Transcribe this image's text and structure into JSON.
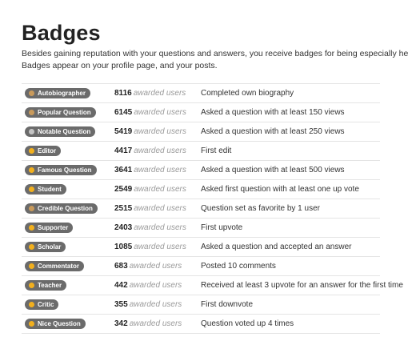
{
  "page": {
    "title": "Badges",
    "intro_line1": "Besides gaining reputation with your questions and answers, you receive badges for being especially helpful.",
    "intro_line2": "Badges appear on your profile  page, and your posts."
  },
  "awarded_label": "awarded users",
  "colors": {
    "gold": "#f2b01e",
    "silver": "#c4c4c4",
    "bronze": "#c99a5b",
    "badge_bg": "#6b6b6b"
  },
  "badges": [
    {
      "name": "Autobiographer",
      "tier": "bronze",
      "count": "8116",
      "description": "Completed own biography"
    },
    {
      "name": "Popular Question",
      "tier": "bronze",
      "count": "6145",
      "description": "Asked a question with at least 150 views"
    },
    {
      "name": "Notable Question",
      "tier": "silver",
      "count": "5419",
      "description": "Asked a question with at least 250 views"
    },
    {
      "name": "Editor",
      "tier": "gold",
      "count": "4417",
      "description": "First edit"
    },
    {
      "name": "Famous Question",
      "tier": "gold",
      "count": "3641",
      "description": "Asked a question with at least 500 views"
    },
    {
      "name": "Student",
      "tier": "gold",
      "count": "2549",
      "description": "Asked first question with at least one up vote"
    },
    {
      "name": "Credible Question",
      "tier": "bronze",
      "count": "2515",
      "description": "Question set as favorite by 1 user"
    },
    {
      "name": "Supporter",
      "tier": "gold",
      "count": "2403",
      "description": "First upvote"
    },
    {
      "name": "Scholar",
      "tier": "gold",
      "count": "1085",
      "description": "Asked a question and accepted an answer"
    },
    {
      "name": "Commentator",
      "tier": "gold",
      "count": "683",
      "description": "Posted 10 comments"
    },
    {
      "name": "Teacher",
      "tier": "gold",
      "count": "442",
      "description": "Received at least 3 upvote for an answer for the first time"
    },
    {
      "name": "Critic",
      "tier": "gold",
      "count": "355",
      "description": "First downvote"
    },
    {
      "name": "Nice Question",
      "tier": "gold",
      "count": "342",
      "description": "Question voted up 4 times"
    }
  ]
}
